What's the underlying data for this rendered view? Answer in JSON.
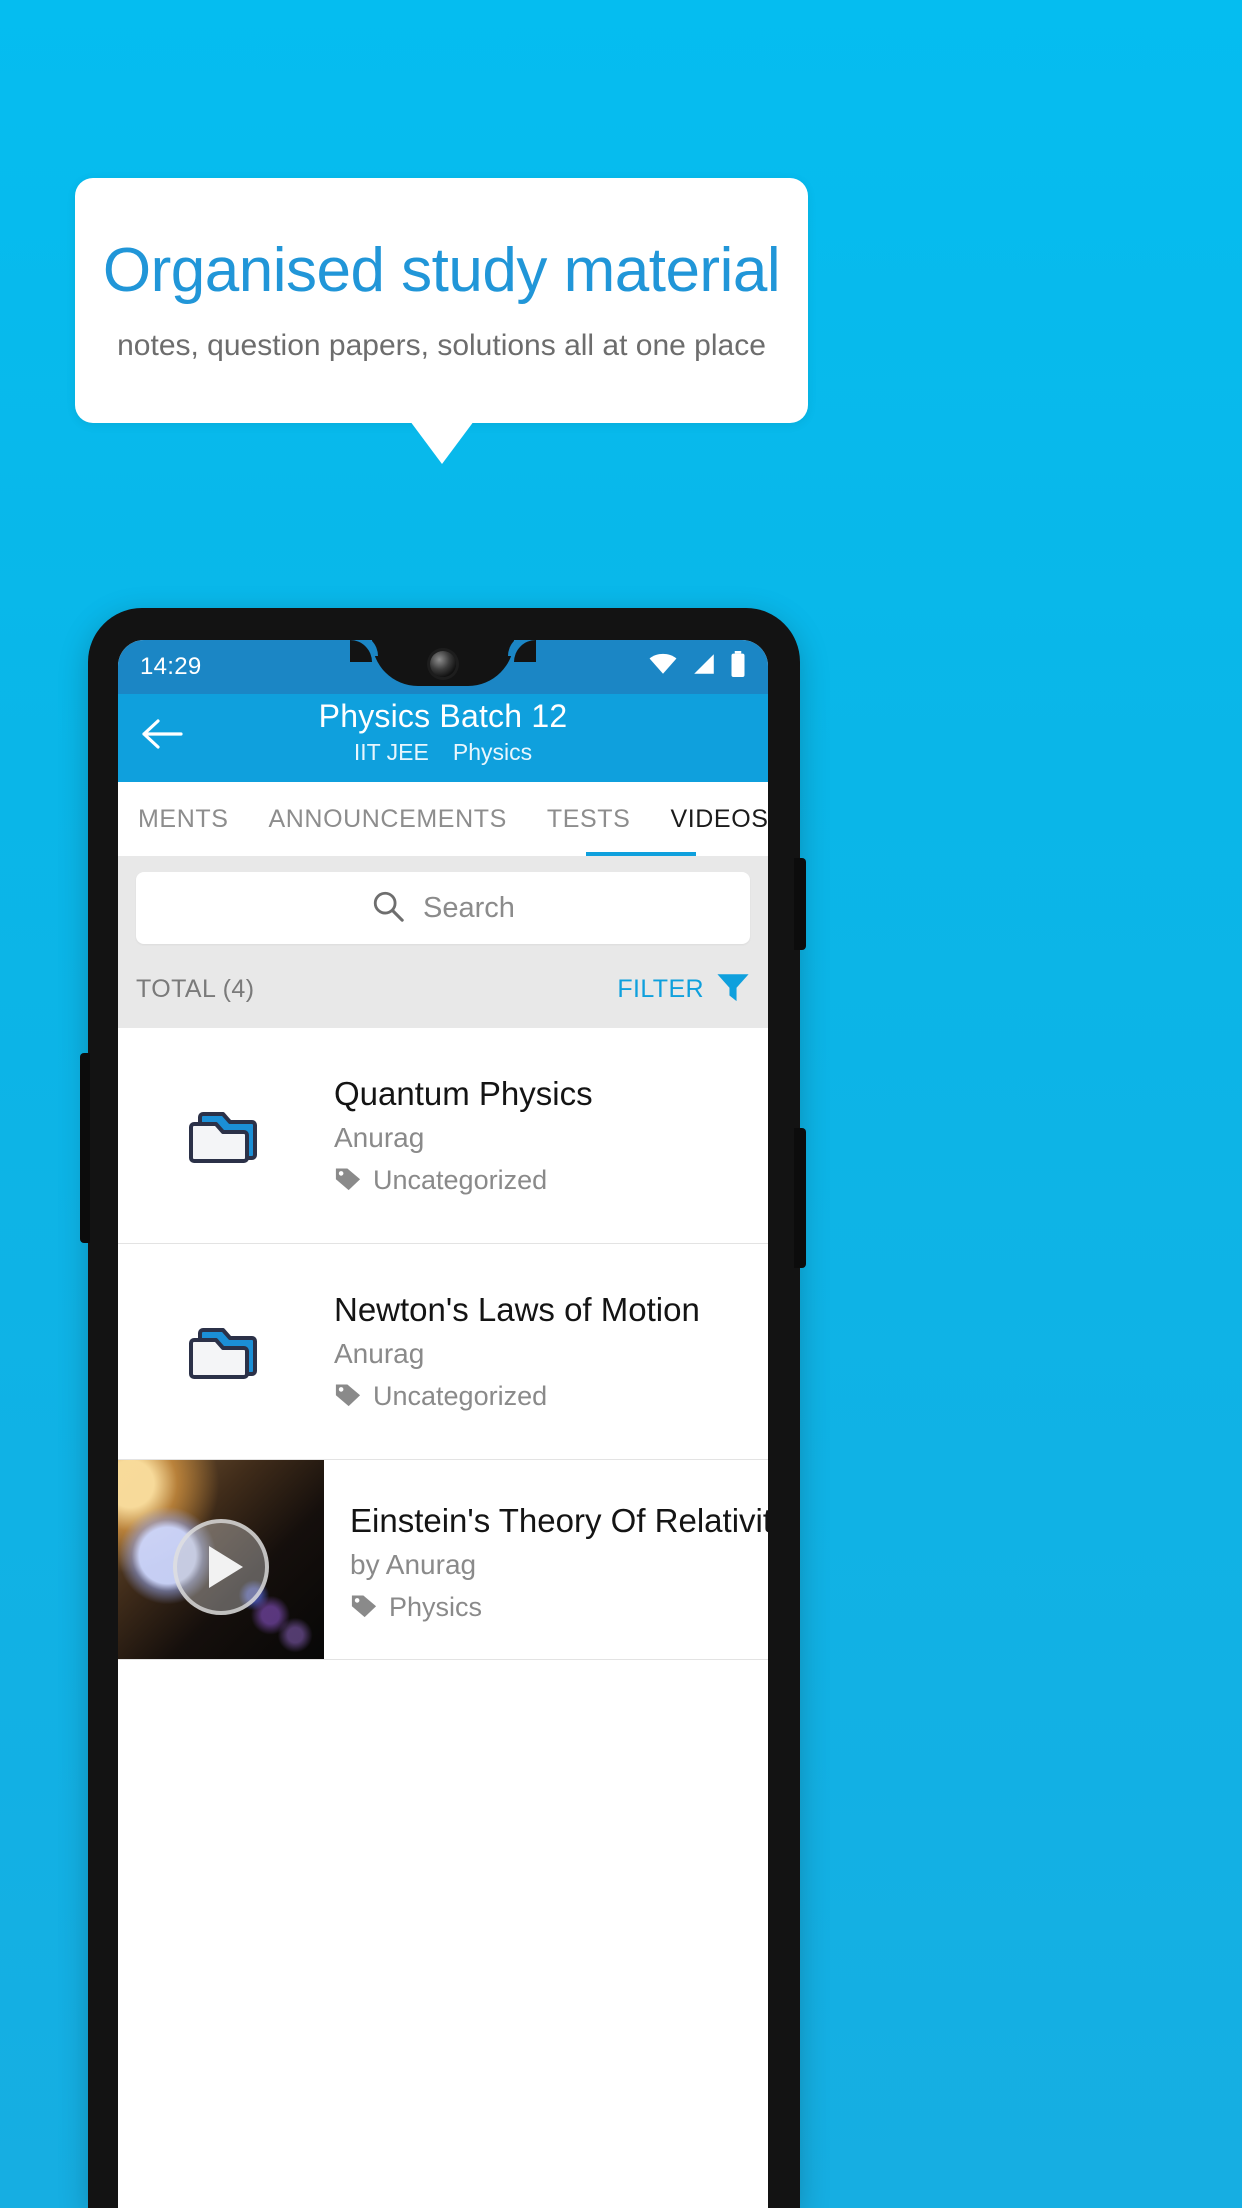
{
  "promo": {
    "title": "Organised study material",
    "subtitle": "notes, question papers, solutions all at one place",
    "accent_color": "#2196d8",
    "background_color": "#0ab6e8"
  },
  "phone": {
    "statusbar": {
      "time": "14:29",
      "icons": [
        "wifi-icon",
        "signal-icon",
        "battery-icon"
      ],
      "background_color": "#1b86c5"
    },
    "appbar": {
      "back_icon": "arrow-left-icon",
      "title": "Physics Batch 12",
      "subtitle_exam": "IIT JEE",
      "subtitle_subject": "Physics",
      "background_color": "#0fa0dd"
    },
    "tabs": [
      {
        "label": "MENTS",
        "active": false
      },
      {
        "label": "ANNOUNCEMENTS",
        "active": false
      },
      {
        "label": "TESTS",
        "active": false
      },
      {
        "label": "VIDEOS",
        "active": true
      }
    ],
    "search": {
      "icon": "search-icon",
      "placeholder": "Search",
      "value": ""
    },
    "listbar": {
      "total_label": "TOTAL (4)",
      "filter_label": "FILTER",
      "filter_icon": "filter-icon",
      "filter_color": "#0fa0dd"
    },
    "list": [
      {
        "type": "folder",
        "icon": "folder-icon",
        "title": "Quantum Physics",
        "author": "Anurag",
        "tag_icon": "tag-icon",
        "tag": "Uncategorized"
      },
      {
        "type": "folder",
        "icon": "folder-icon",
        "title": "Newton's Laws of Motion",
        "author": "Anurag",
        "tag_icon": "tag-icon",
        "tag": "Uncategorized"
      },
      {
        "type": "video",
        "icon": "video-thumbnail",
        "play_icon": "play-icon",
        "title": "Einstein's Theory Of Relativity",
        "author": "by Anurag",
        "tag_icon": "tag-icon",
        "tag": "Physics"
      }
    ]
  }
}
